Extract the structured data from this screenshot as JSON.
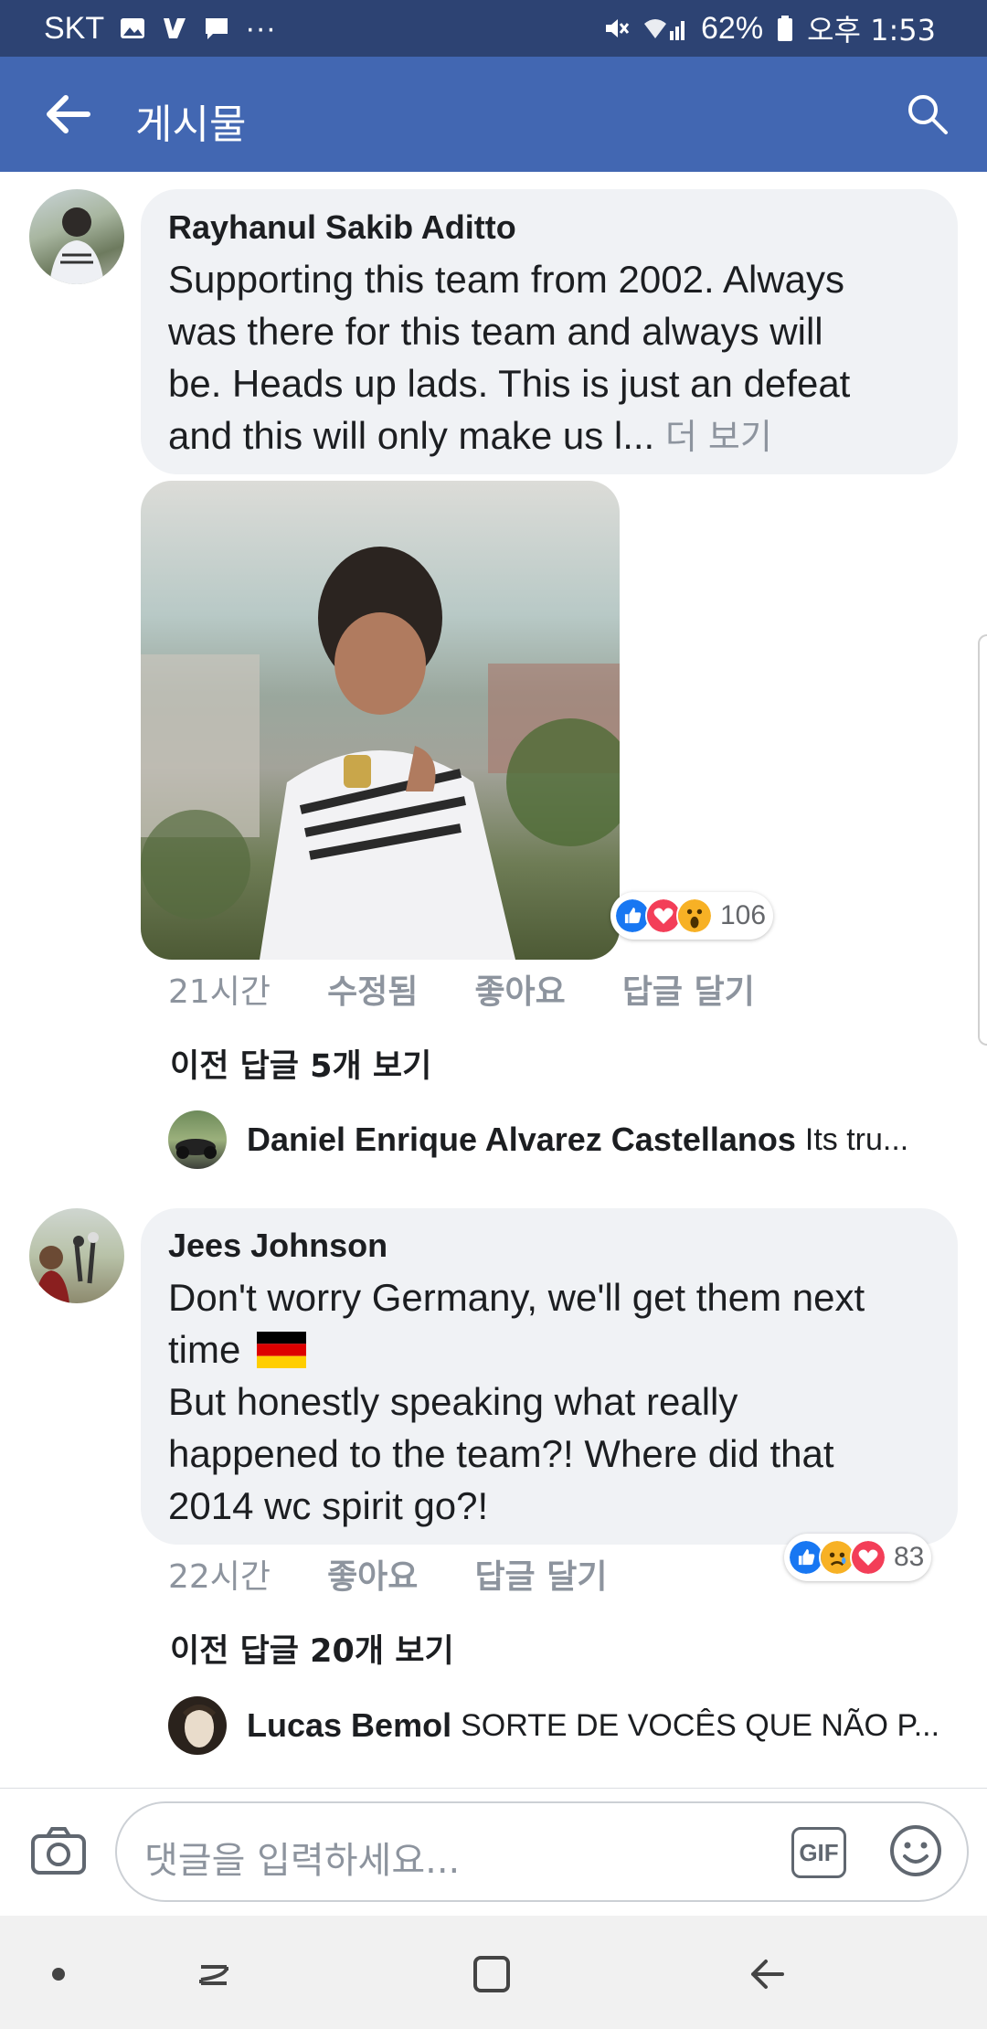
{
  "status_bar": {
    "carrier": "SKT",
    "more": "···",
    "battery": "62%",
    "time": "오후 1:53"
  },
  "header": {
    "title": "게시물",
    "back_icon": "arrow-left-icon",
    "search_icon": "search-icon"
  },
  "comments": [
    {
      "author": "Rayhanul Sakib Aditto",
      "text_lines": [
        "Supporting this team from 2002. Always",
        "was there for this team and always will",
        "be. Heads up lads. This is just an defeat",
        "and this will only make us  l..."
      ],
      "see_more": "더 보기",
      "time": "21시간",
      "edited": "수정됨",
      "like": "좋아요",
      "reply": "답글 달기",
      "reaction_count": "106",
      "previous_replies": "이전 답글 5개 보기",
      "latest_reply": {
        "name": "Daniel Enrique Alvarez Castellanos",
        "text": "Its tru..."
      }
    },
    {
      "author": "Jees Johnson",
      "text_lines": [
        "Don't worry Germany, we'll get them next",
        "time",
        "But honestly speaking what really",
        "happened to the team?! Where did that",
        "2014 wc spirit go?!"
      ],
      "time": "22시간",
      "like": "좋아요",
      "reply": "답글 달기",
      "reaction_count": "83",
      "previous_replies": "이전 답글 20개 보기",
      "latest_reply": {
        "name": "Lucas Bemol",
        "text": "SORTE DE VOCÊS QUE NÃO P..."
      }
    }
  ],
  "composer": {
    "placeholder": "댓글을 입력하세요...",
    "gif_label": "GIF"
  },
  "colors": {
    "header": "#4267b2",
    "status_bar": "#2d4373",
    "bubble": "#f0f2f5",
    "like": "#1877f2",
    "love": "#f33e58",
    "wow": "#f7b125"
  }
}
